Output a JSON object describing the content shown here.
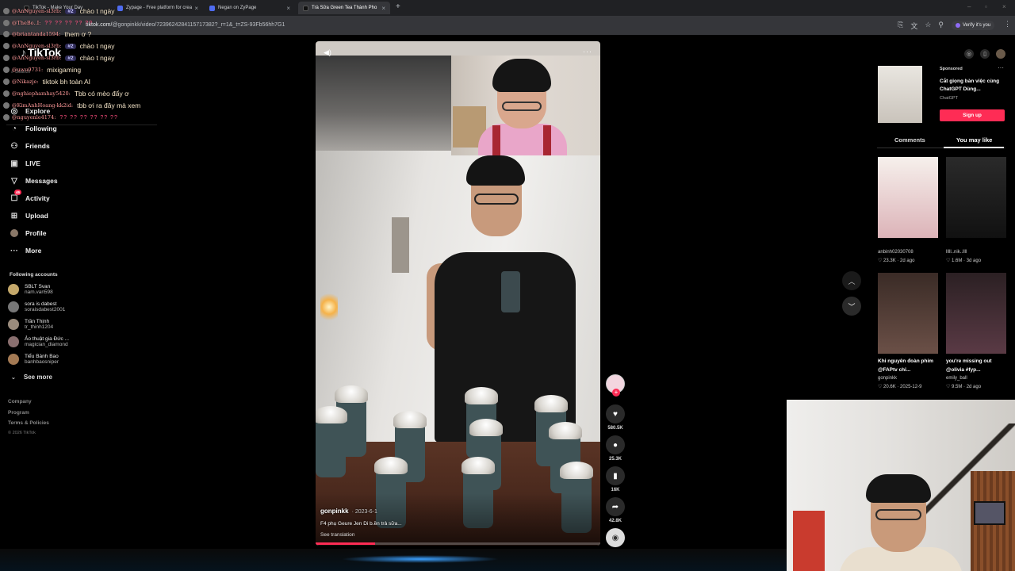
{
  "browser": {
    "tabs": [
      {
        "label": "TikTok - Make Your Day",
        "active": false
      },
      {
        "label": "Zypage - Free platform for crea",
        "active": false
      },
      {
        "label": "Negan on ZyPage",
        "active": false
      },
      {
        "label": "Trà Sữa Green Tea Thành Pho",
        "active": true
      }
    ],
    "url_prefix": "tiktok.com/",
    "url_path": "@gonpinkk/video/7239624284115717382?_r=1&_t=ZS-93Fb56hh7G1",
    "verify_label": "Verify it's you"
  },
  "chat": [
    {
      "user": "@AnNguyen-sl3rb:",
      "rank": "#2",
      "msg": "chào t ngày"
    },
    {
      "user": "@TheBo..I:",
      "emotes": "?? ?? ?? ?? ??",
      "msg": ""
    },
    {
      "user": "@briantanda1594:",
      "msg": "them ơ ?"
    },
    {
      "user": "@AnNguyen-sl3rb:",
      "rank": "#2",
      "msg": "chào t ngay"
    },
    {
      "user": "@AnNguyen-sl3rb:",
      "rank": "#2",
      "msg": "chào t ngay"
    },
    {
      "user": "@uwu9731:",
      "msg": "mixigaming"
    },
    {
      "user": "@Nikazje:",
      "msg": "tiktok bh toàn AI"
    },
    {
      "user": "@nghiephamhay5420:",
      "msg": "Tbb có mèo đẩy ơ"
    },
    {
      "user": "@KimAnhHoang-kk2id:",
      "msg": "tbb ơi ra đây mà xem"
    },
    {
      "user": "@nguyenle4174:",
      "emotes": "?? ?? ?? ?? ?? ??",
      "msg": ""
    }
  ],
  "sidebar": {
    "logo": "TikTok",
    "search": "Search",
    "nav": [
      {
        "label": "Explore",
        "icon": "compass-icon"
      },
      {
        "label": "Following",
        "icon": "following-icon"
      },
      {
        "label": "Friends",
        "icon": "friends-icon"
      },
      {
        "label": "LIVE",
        "icon": "live-icon"
      },
      {
        "label": "Messages",
        "icon": "messages-icon"
      },
      {
        "label": "Activity",
        "icon": "activity-icon",
        "badge": "46"
      },
      {
        "label": "Upload",
        "icon": "upload-icon"
      },
      {
        "label": "Profile",
        "icon": "profile-icon"
      },
      {
        "label": "More",
        "icon": "more-icon"
      }
    ],
    "following_heading": "Following accounts",
    "accounts": [
      {
        "name": "SBLT Svan",
        "handle": "nam.van598"
      },
      {
        "name": "sora is dabest",
        "handle": "soraisdabest2001"
      },
      {
        "name": "Trần Thịnh",
        "handle": "tr_thinh1204"
      },
      {
        "name": "Ảo thuật gia Đức ...",
        "handle": "magician_diamond"
      },
      {
        "name": "Tiểu Bánh Bao",
        "handle": "banhbaosniper"
      }
    ],
    "see_more": "See more",
    "footer": [
      "Company",
      "Program",
      "Terms & Policies"
    ],
    "copyright": "© 2026 TikTok"
  },
  "video": {
    "author": "gonpinkk",
    "date": "· 2023-6-1",
    "description": "F4 phụ Geure Jen Di b.ền trả sữa...",
    "see_translation": "See translation",
    "progress": 0.21
  },
  "actions": {
    "likes": "580.5K",
    "comments": "25.3K",
    "saves": "16K",
    "shares": "42.8K"
  },
  "ad": {
    "sponsored": "Sponsored",
    "title": "Cắt giọng bàn việc cùng ChatGPT Dùng...",
    "brand": "ChatGPT",
    "cta": "Sign up"
  },
  "right_tabs": {
    "comments": "Comments",
    "you_may_like": "You may like"
  },
  "cards": [
    {
      "title": "",
      "user": "anbinh02030708",
      "meta": "♡ 23.3K · 2d ago"
    },
    {
      "title": "",
      "user": "lllll..nik..llll",
      "meta": "♡ 1.6M · 3d ago"
    },
    {
      "title": "Khi nguyên đoàn phim @FAPtv chỉ...",
      "user": "gonpinkk",
      "meta": "♡ 20.6K · 2025-12-9"
    },
    {
      "title": "you're missing out @olivia #fyp...",
      "user": "emily_ball",
      "meta": "♡ 9.5M · 2d ago"
    }
  ]
}
